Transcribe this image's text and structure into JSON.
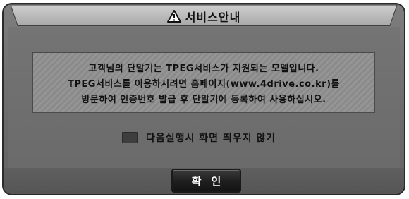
{
  "dialog": {
    "title": "서비스안내",
    "title_icon": "warning-triangle-icon",
    "message_lines": [
      "고객님의 단말기는 TPEG서비스가 지원되는 모델입니다.",
      "TPEG서비스를 이용하시려면 홈페이지(www.4drive.co.kr)를",
      "방문하여 인증번호 발급 후 단말기에 등록하여 사용하십시오."
    ],
    "checkbox_label": "다음실행시 화면 띄우지 않기",
    "checkbox_checked": false,
    "ok_label": "확인"
  }
}
